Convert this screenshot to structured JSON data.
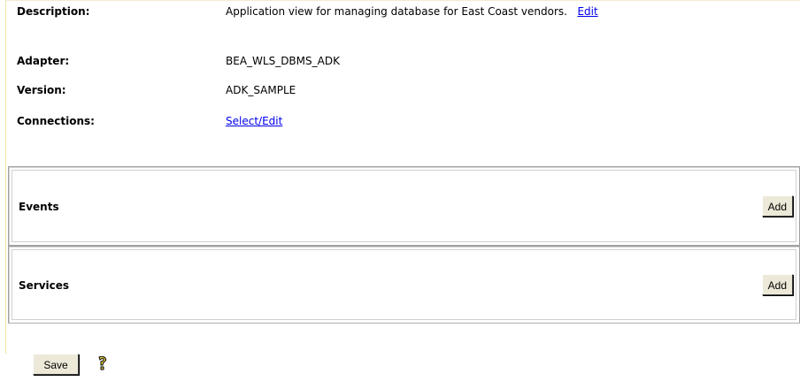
{
  "properties": {
    "description_label": "Description:",
    "description_value": "Application view for managing database for East Coast vendors.",
    "description_edit": "Edit",
    "adapter_label": "Adapter:",
    "adapter_value": "BEA_WLS_DBMS_ADK",
    "version_label": "Version:",
    "version_value": "ADK_SAMPLE",
    "connections_label": "Connections:",
    "connections_link": "Select/Edit"
  },
  "events": {
    "title": "Events",
    "add_label": "Add"
  },
  "services": {
    "title": "Services",
    "add_label": "Add"
  },
  "footer": {
    "save_label": "Save",
    "help_icon": "help-key-icon"
  },
  "colors": {
    "link": "#0000ee",
    "button_face": "#ece9d8",
    "frame_accent": "#f0e3a4"
  }
}
